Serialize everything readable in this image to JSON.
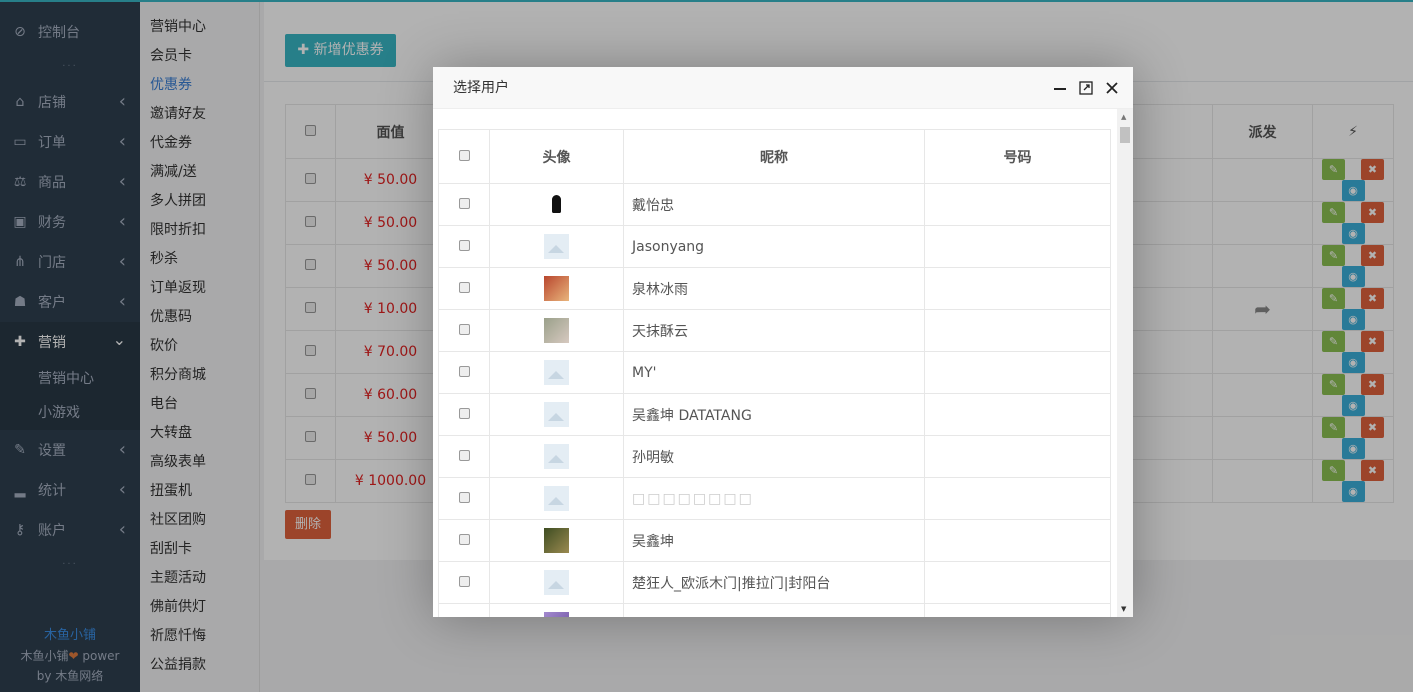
{
  "sidebar": {
    "items": [
      {
        "icon": "dashboard-icon",
        "glyph": "⊘",
        "label": "控制台"
      },
      {
        "icon": "store-icon",
        "glyph": "⌂",
        "label": "店铺"
      },
      {
        "icon": "order-icon",
        "glyph": "▭",
        "label": "订单"
      },
      {
        "icon": "scale-icon",
        "glyph": "⚖",
        "label": "商品"
      },
      {
        "icon": "money-icon",
        "glyph": "▣",
        "label": "财务"
      },
      {
        "icon": "sitemap-icon",
        "glyph": "⋔",
        "label": "门店"
      },
      {
        "icon": "users-icon",
        "glyph": "☗",
        "label": "客户"
      },
      {
        "icon": "gift-icon",
        "glyph": "✚",
        "label": "营销"
      }
    ],
    "sub_items": [
      "营销中心",
      "小游戏"
    ],
    "bottom_items": [
      {
        "icon": "wrench-icon",
        "glyph": "✎",
        "label": "设置"
      },
      {
        "icon": "signal-icon",
        "glyph": "▂",
        "label": "统计"
      },
      {
        "icon": "key-icon",
        "glyph": "⚷",
        "label": "账户"
      }
    ],
    "footer_brand": "木鱼小铺",
    "footer_power_1": "木鱼小铺",
    "footer_power_2": " power",
    "footer_power_3": "by 木鱼网络"
  },
  "submenu": {
    "items": [
      "营销中心",
      "会员卡",
      "优惠券",
      "邀请好友",
      "代金券",
      "满减/送",
      "多人拼团",
      "限时折扣",
      "秒杀",
      "订单返现",
      "优惠码",
      "砍价",
      "积分商城",
      "电台",
      "大转盘",
      "高级表单",
      "扭蛋机",
      "社区团购",
      "刮刮卡",
      "主题活动",
      "佛前供灯",
      "祈愿忏悔",
      "公益捐款"
    ],
    "active_index": 2
  },
  "main": {
    "add_button": "新增优惠券",
    "delete_button": "删除",
    "columns": {
      "value": "面值",
      "dispatch": "派发",
      "ops": "⚡"
    },
    "prices": [
      "¥ 50.00",
      "¥ 50.00",
      "¥ 50.00",
      "¥ 10.00",
      "¥ 70.00",
      "¥ 60.00",
      "¥ 50.00",
      "¥ 1000.00"
    ],
    "share_row": 3
  },
  "modal": {
    "title": "选择用户",
    "columns": {
      "avatar": "头像",
      "nickname": "昵称",
      "phone": "号码"
    },
    "users": [
      {
        "avatar": "p1",
        "name": "戴怡忠"
      },
      {
        "avatar": "ph",
        "name": "Jasonyang"
      },
      {
        "avatar": "p2",
        "name": "泉林冰雨"
      },
      {
        "avatar": "p3",
        "name": "天抹酥云"
      },
      {
        "avatar": "ph",
        "name": "MY'"
      },
      {
        "avatar": "ph",
        "name": "吴鑫坤 DATATANG"
      },
      {
        "avatar": "ph",
        "name": "孙明敏"
      },
      {
        "avatar": "ph",
        "name": "□□□□□□□□",
        "faded": true
      },
      {
        "avatar": "p4",
        "name": "吴鑫坤"
      },
      {
        "avatar": "ph",
        "name": "楚狂人_欧派木门|推拉门|封阳台"
      },
      {
        "avatar": "p5",
        "name": ""
      }
    ]
  }
}
